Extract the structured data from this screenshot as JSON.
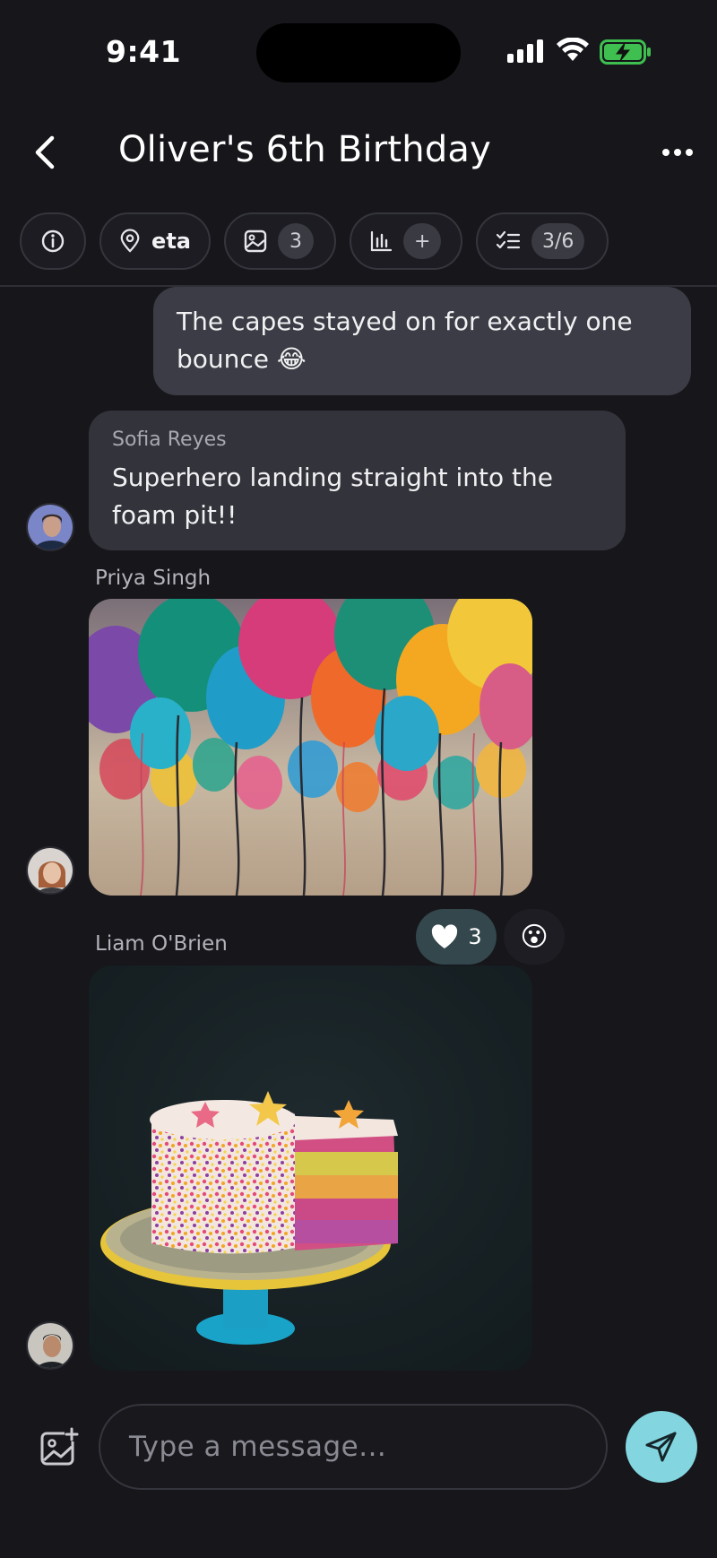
{
  "status_bar": {
    "time": "9:41"
  },
  "header": {
    "title": "Oliver's 6th Birthday"
  },
  "chips": {
    "location_label": "eta",
    "photos_count": "3",
    "poll_count": "+",
    "tasks_count": "3/6"
  },
  "messages": {
    "outgoing_text": "The capes stayed on for exactly one bounce 😂",
    "sofia": {
      "sender": "Sofia Reyes",
      "text": "Superhero landing straight into the foam pit!!"
    },
    "priya": {
      "sender": "Priya Singh"
    },
    "liam": {
      "sender": "Liam O'Brien"
    }
  },
  "reactions": {
    "heart_count": "3",
    "wow_emoji": "😮"
  },
  "composer": {
    "placeholder": "Type a message..."
  },
  "colors": {
    "accent": "#83d6df",
    "background": "#16161b",
    "bubble_out": "#3b3c45",
    "bubble_in": "#33333b"
  }
}
